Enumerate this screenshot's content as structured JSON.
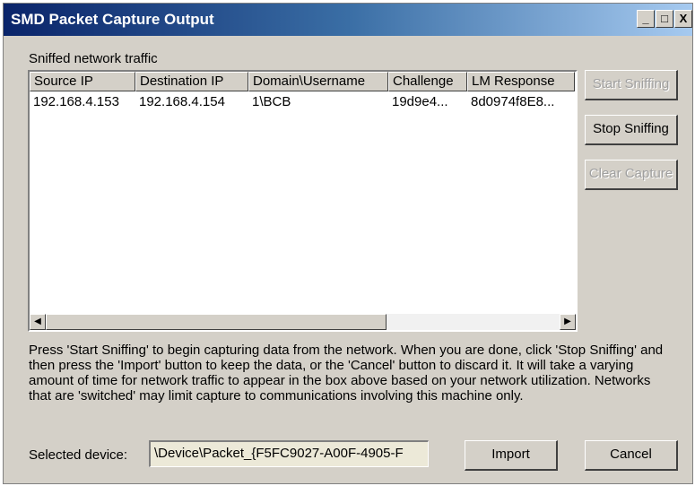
{
  "window": {
    "title": "SMD Packet Capture Output",
    "minimize_glyph": "_",
    "maximize_glyph": "□",
    "close_glyph": "X"
  },
  "capture": {
    "group_label": "Sniffed network traffic",
    "columns": [
      "Source IP",
      "Destination IP",
      "Domain\\Username",
      "Challenge",
      "LM Response"
    ],
    "rows": [
      [
        "192.168.4.153",
        "192.168.4.154",
        "1\\BCB",
        "19d9e4...",
        "8d0974f8E8..."
      ]
    ]
  },
  "scrollbar": {
    "left_glyph": "◀",
    "right_glyph": "▶"
  },
  "side_buttons": {
    "start_label": "Start Sniffing",
    "stop_label": "Stop Sniffing",
    "clear_label": "Clear Capture"
  },
  "help_text": "Press 'Start Sniffing' to begin capturing data from the network. When you are done, click 'Stop Sniffing' and then press the 'Import' button to keep the data, or the 'Cancel' button to discard it. It will take a varying amount of time for network traffic to appear in the box above based on your network utilization. Networks that are 'switched' may limit capture to communications involving this machine only.",
  "device": {
    "label": "Selected device:",
    "value": "\\Device\\Packet_{F5FC9027-A00F-4905-F"
  },
  "bottom_buttons": {
    "import_label": "Import",
    "cancel_label": "Cancel"
  }
}
